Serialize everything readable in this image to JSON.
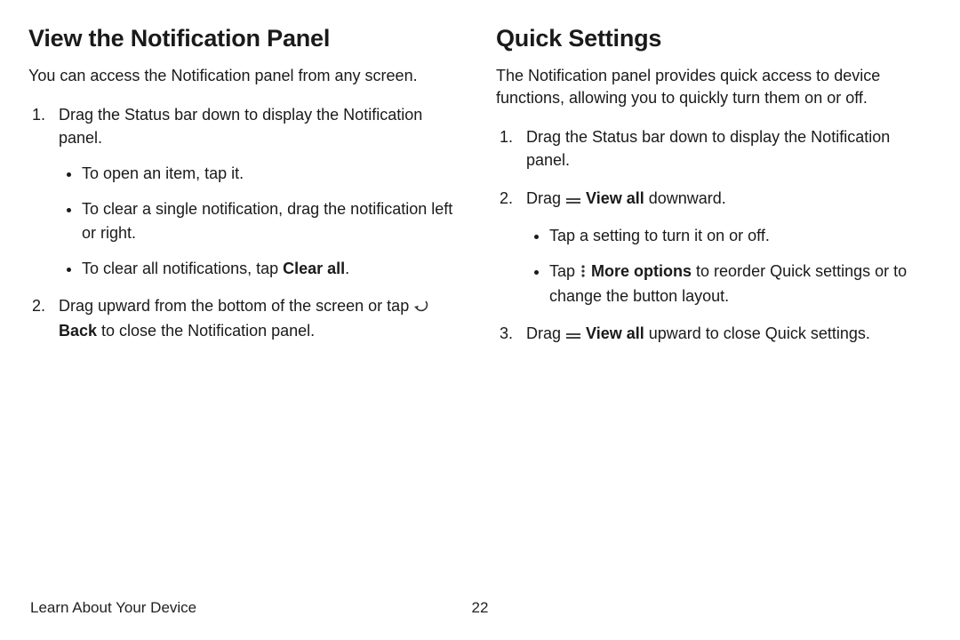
{
  "left": {
    "heading": "View the Notification Panel",
    "intro": "You can access the Notification panel from any screen.",
    "step1": "Drag the Status bar down to display the Notification panel.",
    "bullets": {
      "b1": "To open an item, tap it.",
      "b2": "To clear a single notification, drag the notification left or right.",
      "b3_pre": "To clear all notifications, tap ",
      "b3_bold": "Clear all",
      "b3_post": "."
    },
    "step2_pre": "Drag upward from the bottom of the screen or tap ",
    "step2_bold": " Back",
    "step2_post": " to close the Notification panel."
  },
  "right": {
    "heading": "Quick Settings",
    "intro": "The Notification panel provides quick access to device functions, allowing you to quickly turn them on or off.",
    "step1": "Drag the Status bar down to display the Notification panel.",
    "step2_pre": "Drag ",
    "step2_bold": " View all",
    "step2_post": " downward.",
    "bullets": {
      "b1": "Tap a setting to turn it on or off.",
      "b2_pre": "Tap ",
      "b2_bold": " More options",
      "b2_post": " to reorder Quick settings or to change the button layout."
    },
    "step3_pre": "Drag ",
    "step3_bold": " View all",
    "step3_post": " upward to close Quick settings."
  },
  "footer": {
    "section": "Learn About Your Device",
    "page": "22"
  }
}
